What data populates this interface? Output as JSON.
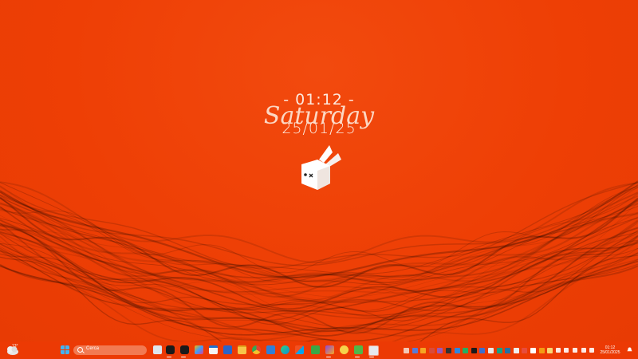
{
  "clock": {
    "time": "- 01:12 -",
    "day": "Saturday",
    "date": "25/01/25"
  },
  "taskbar": {
    "search_placeholder": "Cerca",
    "weather_temp": "13°",
    "pinned_icons": [
      "start-icon",
      "search-bar",
      "task-view-icon",
      "app-dark-1-icon",
      "app-dark-2-icon",
      "photos-icon",
      "calendar-icon",
      "word-icon",
      "file-explorer-icon",
      "chrome-icon",
      "app-blue-1-icon",
      "edge-icon",
      "store-icon",
      "app-green-icon",
      "app-extra-1-icon",
      "app-extra-2-icon",
      "app-extra-3-icon"
    ],
    "tray_icons": [
      "tray-1",
      "tray-2",
      "tray-3",
      "tray-4",
      "tray-5",
      "tray-6",
      "tray-7",
      "tray-8",
      "tray-9",
      "tray-10",
      "tray-11",
      "tray-12",
      "tray-13",
      "tray-14",
      "tray-15",
      "tray-16",
      "tray-17",
      "tray-18",
      "tray-19",
      "tray-20",
      "tray-21",
      "tray-22",
      "tray-23"
    ],
    "sys_time": "01:12",
    "sys_date": "25/01/2025"
  },
  "colors": {
    "background": "#ef3d05",
    "clock_text": "#fde9de"
  }
}
